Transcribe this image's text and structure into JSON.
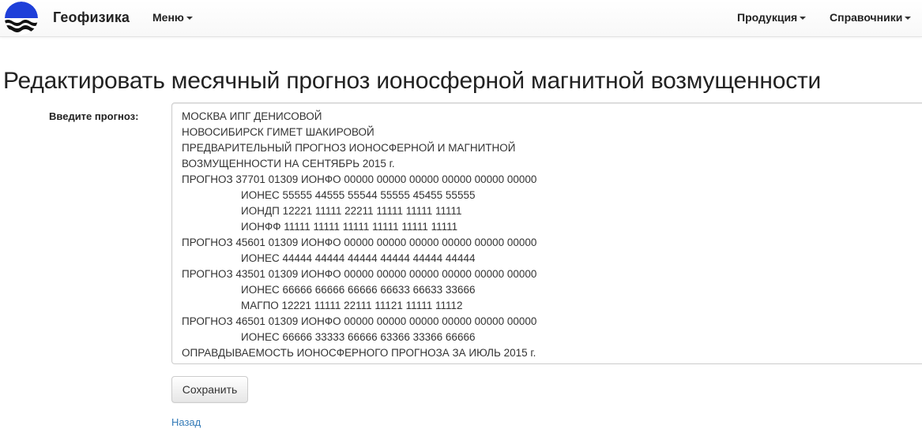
{
  "navbar": {
    "brand": "Геофизика",
    "menu_label": "Меню",
    "products_label": "Продукция",
    "references_label": "Справочники",
    "logo_icon": "sun-over-waves-logo"
  },
  "page": {
    "title": "Редактировать месячный прогноз ионосферной магнитной возмущенности"
  },
  "form": {
    "label": "Введите прогноз:",
    "forecast_text": "МОСКВА ИПГ ДЕНИСОВОЙ\nНОВОСИБИРСК ГИМЕТ ШАКИРОВОЙ\nПРЕДВАРИТЕЛЬНЫЙ ПРОГНОЗ ИОНОСФЕРНОЙ И МАГНИТНОЙ\nВОЗМУЩЕННОСТИ НА СЕНТЯБРЬ 2015 г.\nПРОГНОЗ 37701 01309 ИОНФО 00000 00000 00000 00000 00000 00000\n                    ИОНЕС 55555 44555 55544 55555 45455 55555\n                    ИОНДП 12221 11111 22211 11111 11111 11111\n                    ИОНФФ 11111 11111 11111 11111 11111 11111\nПРОГНОЗ 45601 01309 ИОНФО 00000 00000 00000 00000 00000 00000\n                    ИОНЕС 44444 44444 44444 44444 44444 44444\nПРОГНОЗ 43501 01309 ИОНФО 00000 00000 00000 00000 00000 00000\n                    ИОНЕС 66666 66666 66666 66633 66633 33666\n                    МАГПО 12221 11111 22111 11121 11111 11112\nПРОГНОЗ 46501 01309 ИОНФО 00000 00000 00000 00000 00000 00000\n                    ИОНЕС 66666 33333 66666 63366 33366 66666\nОПРАВДЫВАЕМОСТЬ ИОНОСФЕРНОГО ПРОГНОЗА ЗА ИЮЛЬ 2015 г.",
    "save_label": "Сохранить",
    "back_label": "Назад"
  },
  "colors": {
    "link": "#337ab7",
    "logo_blue": "#1e3fd9",
    "text": "#333333"
  }
}
